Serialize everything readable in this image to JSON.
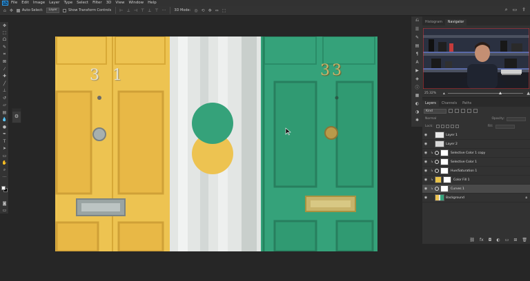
{
  "menu": [
    "File",
    "Edit",
    "Image",
    "Layer",
    "Type",
    "Select",
    "Filter",
    "3D",
    "View",
    "Window",
    "Help"
  ],
  "options_bar": {
    "auto_select_label": "Auto-Select:",
    "auto_select_value": "Layer",
    "transform_label": "Show Transform Controls",
    "mode_label": "3D Mode:"
  },
  "tools": [
    "move-icon",
    "marquee-icon",
    "lasso-icon",
    "quick-select-icon",
    "crop-icon",
    "frame-icon",
    "eyedropper-icon",
    "healing-icon",
    "brush-icon",
    "stamp-icon",
    "history-brush-icon",
    "eraser-icon",
    "gradient-icon",
    "blur-icon",
    "dodge-icon",
    "pen-icon",
    "type-icon",
    "path-select-icon",
    "shape-icon",
    "hand-icon",
    "zoom-icon",
    "more-icon"
  ],
  "canvas": {
    "left_number": "3 1",
    "right_number": "33",
    "colors": {
      "yellow": "#edc351",
      "green": "#35a27a",
      "pillar": "#e3e6e4"
    }
  },
  "navigator": {
    "tabs": [
      "Histogram",
      "Navigator"
    ],
    "zoom": "25.32%"
  },
  "layers": {
    "tabs": [
      "Layers",
      "Channels",
      "Paths"
    ],
    "filter_kind": "Kind",
    "blend_label": "Normal",
    "opacity_label": "Opacity:",
    "lock_label": "Lock:",
    "fill_label": "Fill:",
    "items": [
      {
        "name": "Layer 1",
        "type": "pixel",
        "thumb": "#e8e8e8"
      },
      {
        "name": "Layer 2",
        "type": "pixel",
        "thumb": "#d8d8d8"
      },
      {
        "name": "Selective Color 1 copy",
        "type": "adj"
      },
      {
        "name": "Selective Color 1",
        "type": "adj"
      },
      {
        "name": "Hue/Saturation 1",
        "type": "adj"
      },
      {
        "name": "Color Fill 1",
        "type": "fill",
        "thumb": "#e8c24a"
      },
      {
        "name": "Curves 1",
        "type": "adj",
        "selected": true
      },
      {
        "name": "Background",
        "type": "bg"
      }
    ]
  }
}
